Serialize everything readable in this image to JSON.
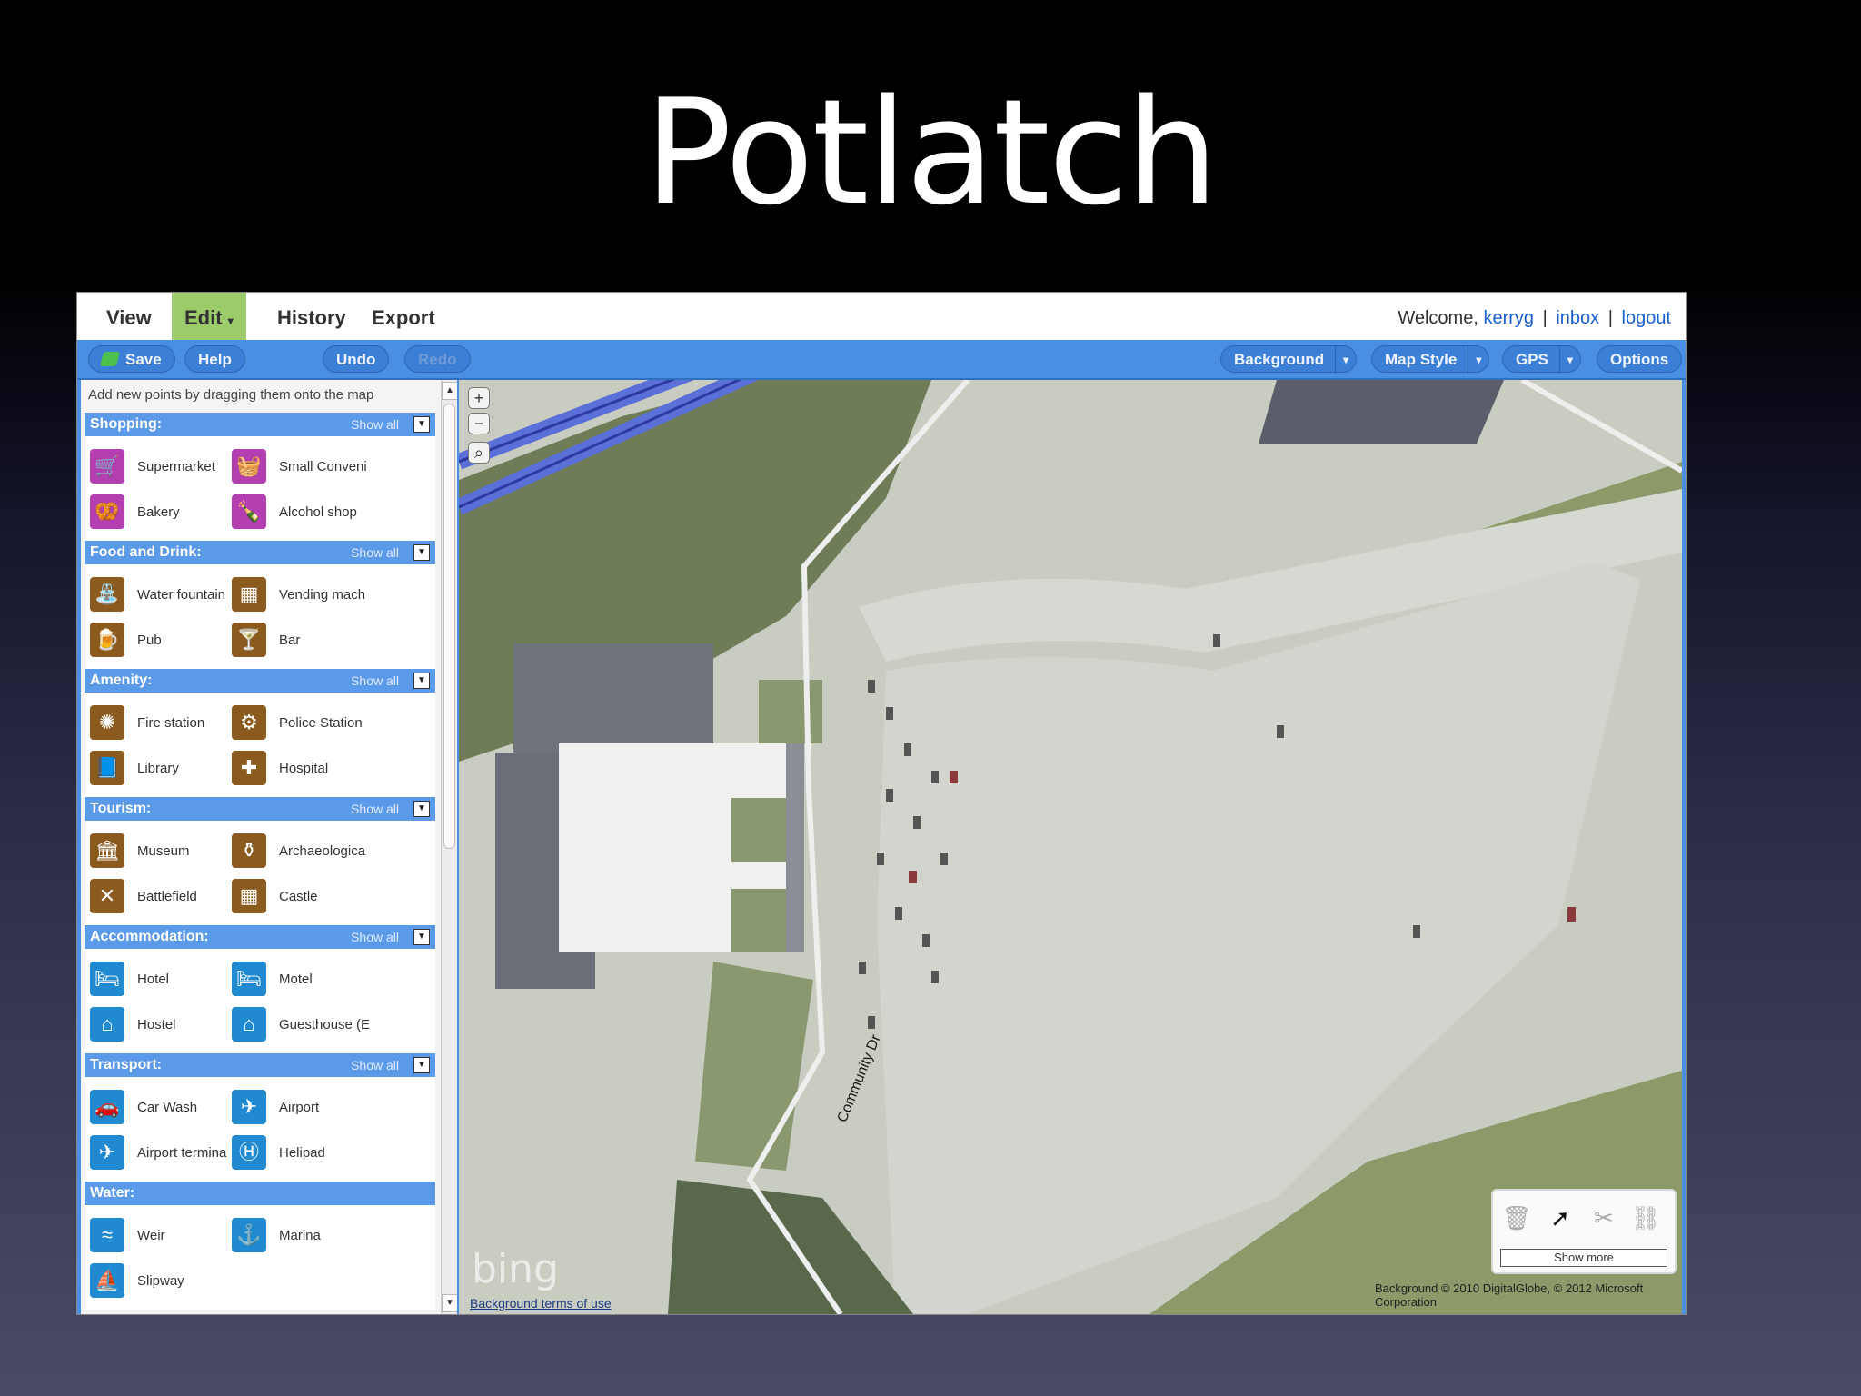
{
  "slide": {
    "title": "Potlatch"
  },
  "menu": {
    "view": "View",
    "edit": "Edit",
    "history": "History",
    "export": "Export",
    "welcome_prefix": "Welcome,",
    "user": "kerryg",
    "inbox": "inbox",
    "logout": "logout",
    "separator": "|"
  },
  "toolbar": {
    "save": "Save",
    "help": "Help",
    "undo": "Undo",
    "redo": "Redo",
    "background": "Background",
    "map_style": "Map Style",
    "gps": "GPS",
    "options": "Options"
  },
  "panel": {
    "hint": "Add new points by dragging them onto the map",
    "show_all": "Show all",
    "categories": [
      {
        "name": "Shopping:",
        "items": [
          "Supermarket",
          "Small Conveni",
          "Bakery",
          "Alcohol shop"
        ]
      },
      {
        "name": "Food and Drink:",
        "items": [
          "Water fountain",
          "Vending mach",
          "Pub",
          "Bar"
        ]
      },
      {
        "name": "Amenity:",
        "items": [
          "Fire station",
          "Police Station",
          "Library",
          "Hospital"
        ]
      },
      {
        "name": "Tourism:",
        "items": [
          "Museum",
          "Archaeologica",
          "Battlefield",
          "Castle"
        ]
      },
      {
        "name": "Accommodation:",
        "items": [
          "Hotel",
          "Motel",
          "Hostel",
          "Guesthouse (E"
        ]
      },
      {
        "name": "Transport:",
        "items": [
          "Car Wash",
          "Airport",
          "Airport termina",
          "Helipad"
        ]
      },
      {
        "name": "Water:",
        "items": [
          "Weir",
          "Marina",
          "Slipway"
        ]
      }
    ]
  },
  "map": {
    "street_label": "Community Dr",
    "bing_logo": "bing",
    "terms": "Background terms of use",
    "attribution": "Background © 2010 DigitalGlobe, © 2012 Microsoft Corporation",
    "show_more": "Show more"
  },
  "colors": {
    "toolbar_blue": "#4a90e2",
    "edit_green": "#9ccb6a",
    "shopping_purple": "#b43fb0",
    "food_brown": "#8a5a1e",
    "transport_blue": "#1f8ad0"
  }
}
